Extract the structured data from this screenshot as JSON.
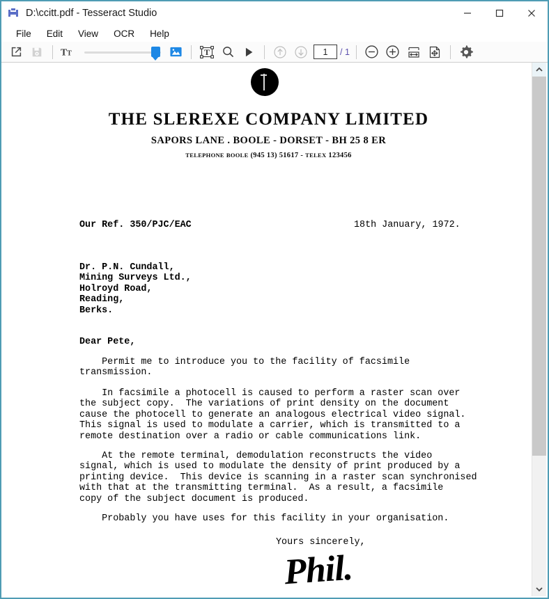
{
  "window": {
    "title": "D:\\ccitt.pdf - Tesseract Studio",
    "logo_icon": "tesseract-logo-icon",
    "controls": {
      "minimize": "minimize-icon",
      "maximize": "maximize-icon",
      "close": "close-icon"
    }
  },
  "menubar": {
    "items": [
      {
        "label": "File"
      },
      {
        "label": "Edit"
      },
      {
        "label": "View"
      },
      {
        "label": "OCR"
      },
      {
        "label": "Help"
      }
    ]
  },
  "toolbar": {
    "open_icon": "open-external-icon",
    "save_icon": "save-disk-icon",
    "text_size_icon": "text-size-icon",
    "slider": {
      "value": 88,
      "min": 0,
      "max": 100
    },
    "image_icon": "image-picture-icon",
    "select_text_icon": "select-text-region-icon",
    "search_icon": "search-icon",
    "run_icon": "run-play-icon",
    "prev_page_icon": "arrow-up-circle-icon",
    "next_page_icon": "arrow-down-circle-icon",
    "page_number": "1",
    "page_total": "/ 1",
    "zoom_out_icon": "zoom-out-circle-icon",
    "zoom_in_icon": "zoom-in-circle-icon",
    "fit_width_icon": "fit-width-icon",
    "fit_page_icon": "fit-page-icon",
    "settings_icon": "gear-icon"
  },
  "scrollbar": {
    "up_icon": "chevron-up-icon",
    "down_icon": "chevron-down-icon"
  },
  "document": {
    "logo_icon": "company-seal-icon",
    "company_name": "THE  SLEREXE  COMPANY  LIMITED",
    "address_line": "SAPORS LANE . BOOLE - DORSET - BH 25  8 ER",
    "contact_line_pre": "TELEPHONE",
    "contact_line_1": "BOOLE",
    "contact_line_2": "(945 13)  51617  -",
    "contact_line_3": "TELEX",
    "contact_line_4": "123456",
    "our_ref": "Our Ref. 350/PJC/EAC",
    "date": "18th January, 1972.",
    "recipient": "Dr. P.N. Cundall,\nMining Surveys Ltd.,\nHolroyd Road,\nReading,\nBerks.",
    "salutation": "Dear Pete,",
    "paragraph_1": "    Permit me to introduce you to the facility of facsimile\ntransmission.",
    "paragraph_2": "    In facsimile a photocell is caused to perform a raster scan over\nthe subject copy.  The variations of print density on the document\ncause the photocell to generate an analogous electrical video signal.\nThis signal is used to modulate a carrier, which is transmitted to a\nremote destination over a radio or cable communications link.",
    "paragraph_3": "    At the remote terminal, demodulation reconstructs the video\nsignal, which is used to modulate the density of print produced by a\nprinting device.  This device is scanning in a raster scan synchronised\nwith that at the transmitting terminal.  As a result, a facsimile\ncopy of the subject document is produced.",
    "paragraph_4": "    Probably you have uses for this facility in your organisation.",
    "closing": "Yours sincerely,",
    "signature": "Phil."
  },
  "colors": {
    "window_border": "#4f9cb4",
    "accent_blue": "#1e88e5",
    "page_total_text": "#5b4fae",
    "scrollbar_thumb": "#c9c9c9"
  }
}
